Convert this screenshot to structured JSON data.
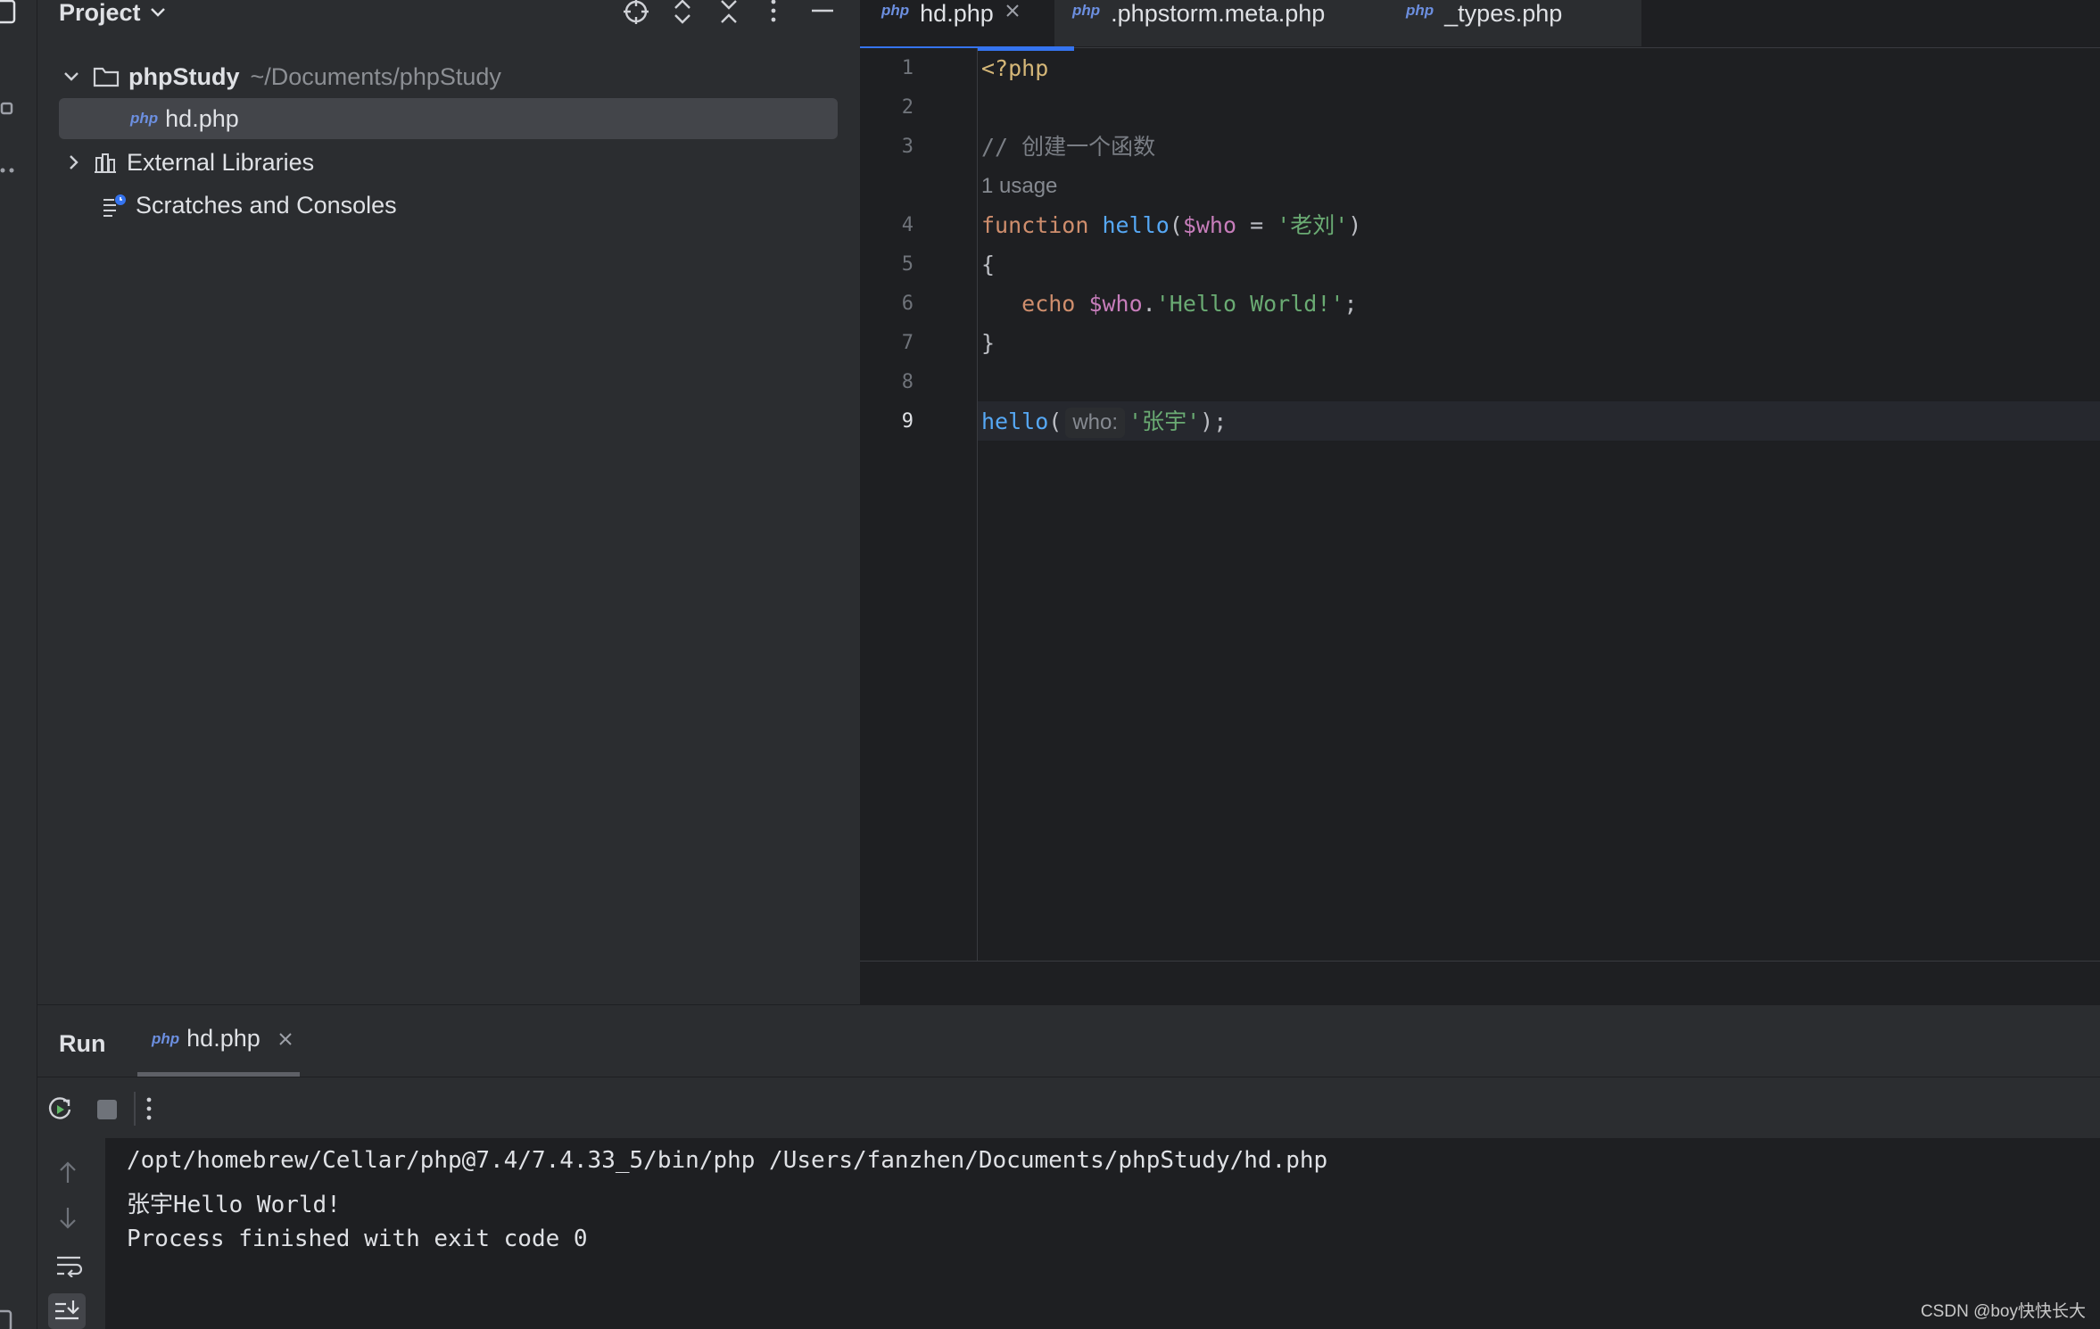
{
  "project": {
    "title": "Project",
    "tree": [
      {
        "label": "phpStudy",
        "path": "~/Documents/phpStudy"
      },
      {
        "label": "hd.php",
        "badge": "php"
      },
      {
        "label": "External Libraries"
      },
      {
        "label": "Scratches and Consoles"
      }
    ]
  },
  "tabs": [
    {
      "label": "hd.php",
      "badge": "php",
      "active": true
    },
    {
      "label": ".phpstorm.meta.php",
      "badge": "php"
    },
    {
      "label": "_types.php",
      "badge": "php"
    }
  ],
  "editor": {
    "line_numbers": [
      "1",
      "2",
      "3",
      "4",
      "5",
      "6",
      "7",
      "8",
      "9"
    ],
    "usage_hint": "1 usage",
    "lines": {
      "l1": "<?php",
      "l3": "// 创建一个函数",
      "l4": {
        "kw": "function",
        "fn": "hello",
        "open": "(",
        "var": "$who",
        "eq": " = ",
        "str": "'老刘'",
        "close": ")"
      },
      "l5": "{",
      "l6": {
        "kw": "echo",
        "var": "$who",
        "dot": ".",
        "str": "'Hello World!'",
        "semi": ";"
      },
      "l7": "}",
      "l9": {
        "fn": "hello",
        "open": "(",
        "inlay": "who:",
        "str": "'张宇'",
        "close": ");"
      }
    }
  },
  "run": {
    "title": "Run",
    "tab": {
      "label": "hd.php",
      "badge": "php"
    },
    "console": [
      "/opt/homebrew/Cellar/php@7.4/7.4.33_5/bin/php /Users/fanzhen/Documents/phpStudy/hd.php",
      "张宇Hello World!",
      "Process finished with exit code 0"
    ]
  },
  "watermark": "CSDN @boy快快长大",
  "colors": {
    "accent": "#3574f0",
    "background": "#1e1f22",
    "panel": "#2b2d30",
    "keyword": "#cf8e6d",
    "function": "#56a8f5",
    "variable": "#c77dbb",
    "string": "#6aab73",
    "php_tag": "#d5b778"
  }
}
